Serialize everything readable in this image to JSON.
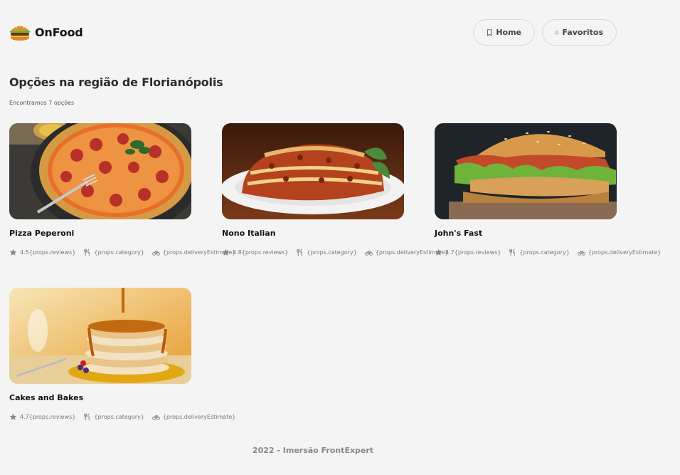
{
  "app": {
    "name": "OnFood"
  },
  "nav": {
    "home_label": "Home",
    "favorites_label": "Favoritos"
  },
  "main": {
    "title": "Opções na região de Florianópolis",
    "count_text": "Encontramos 7 opções",
    "restaurants": [
      {
        "name": "Pizza Peperoni",
        "rating": "4.5{props.reviews}",
        "category": "{props.category}",
        "delivery": "{props.deliveryEstimate}",
        "image": "pizza"
      },
      {
        "name": "Nono Italian",
        "rating": "4.8{props.reviews}",
        "category": "{props.category}",
        "delivery": "{props.deliveryEstimate}",
        "image": "lasagna"
      },
      {
        "name": "John's Fast",
        "rating": "4.7{props.reviews}",
        "category": "{props.category}",
        "delivery": "{props.deliveryEstimate}",
        "image": "burger"
      },
      {
        "name": "Cakes and Bakes",
        "rating": "4.7{props.reviews}",
        "category": "{props.category}",
        "delivery": "{props.deliveryEstimate}",
        "image": "pancakes"
      }
    ]
  },
  "footer": {
    "text": "2022 - Imersão FrontExpert"
  },
  "icons": {
    "logo": "burger-icon",
    "nav": "bookmark-icon",
    "rating": "star-icon",
    "category": "utensils-icon",
    "delivery": "bike-icon"
  }
}
